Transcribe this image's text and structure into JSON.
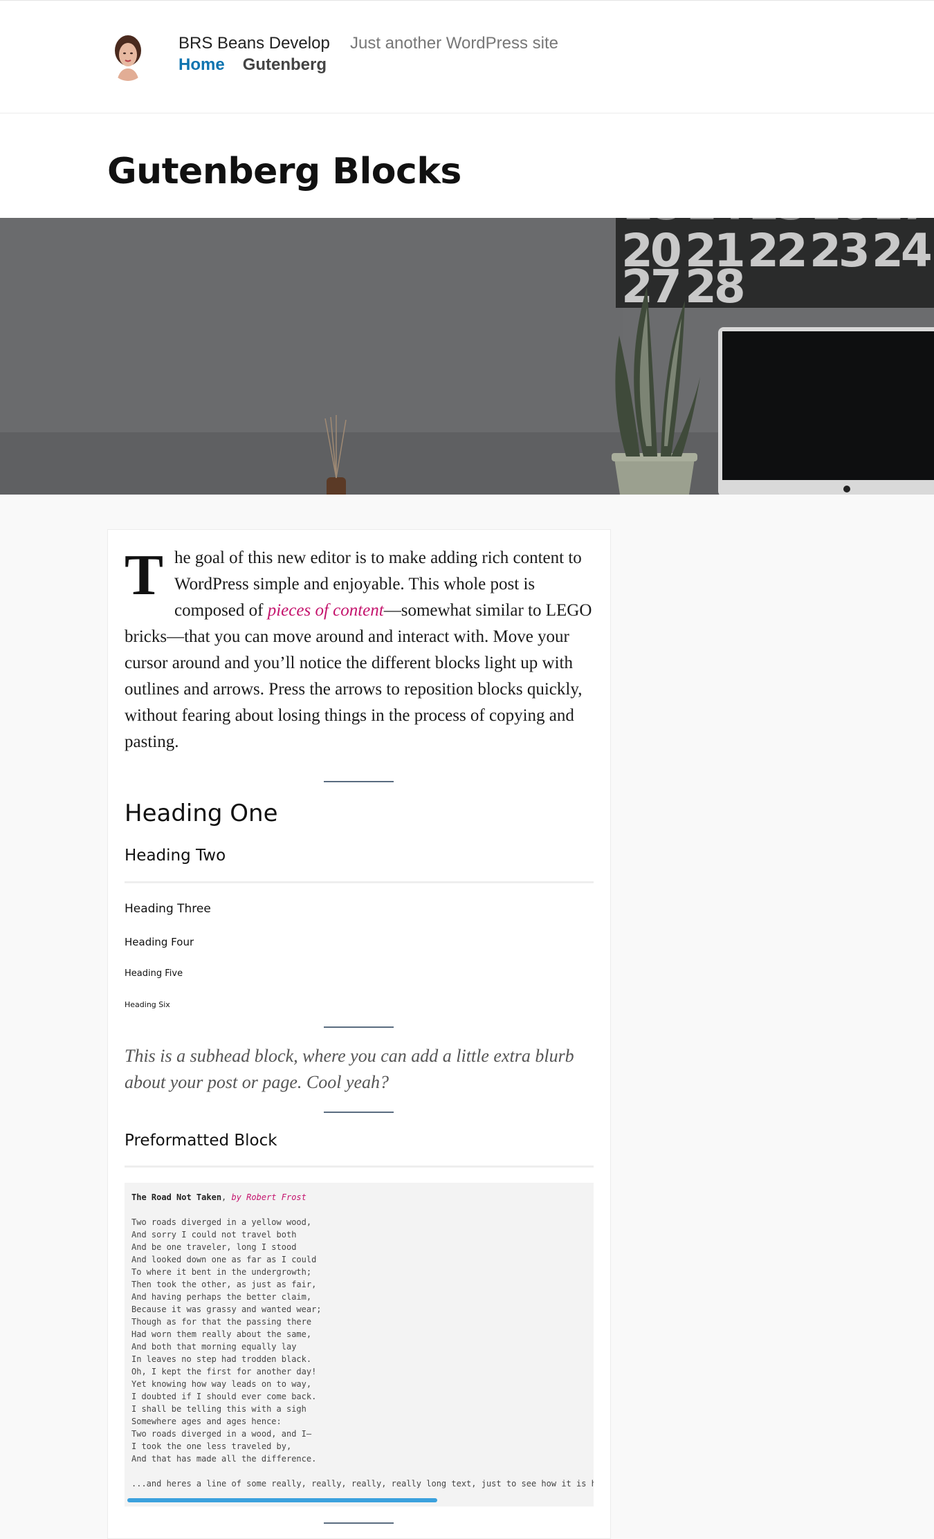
{
  "header": {
    "site_title": "BRS Beans Develop",
    "site_description": "Just another WordPress site",
    "nav": [
      {
        "label": "Home",
        "current": true
      },
      {
        "label": "Gutenberg",
        "current": false
      }
    ],
    "avatar_icon": "avatar"
  },
  "page": {
    "title": "Gutenberg Blocks"
  },
  "hero": {
    "calendar_numbers": [
      "20",
      "21",
      "22",
      "23",
      "24",
      "27",
      "28"
    ]
  },
  "content": {
    "lead_dropcap": "T",
    "lead_before": "he goal of this new editor is to make adding rich content to WordPress simple and enjoyable. This whole post is composed of ",
    "lead_em": "pieces of content",
    "lead_after": "—somewhat similar to LEGO bricks—that you can move around and interact with. Move your cursor around and you’ll notice the different blocks light up with outlines and arrows. Press the arrows to reposition blocks quickly, without fearing about losing things in the process of copying and pasting.",
    "headings": {
      "h1": "Heading One",
      "h2": "Heading Two",
      "h3": "Heading Three",
      "h4": "Heading Four",
      "h5": "Heading Five",
      "h6": "Heading Six"
    },
    "subhead": "This is a subhead block, where you can add a little extra blurb about your post or page. Cool yeah?",
    "preformatted_heading": "Preformatted Block",
    "preformatted": {
      "title": "The Road Not Taken",
      "byline_sep": ", ",
      "byline": "by Robert Frost",
      "body": "Two roads diverged in a yellow wood,\nAnd sorry I could not travel both\nAnd be one traveler, long I stood\nAnd looked down one as far as I could\nTo where it bent in the undergrowth;\nThen took the other, as just as fair,\nAnd having perhaps the better claim,\nBecause it was grassy and wanted wear;\nThough as for that the passing there\nHad worn them really about the same,\nAnd both that morning equally lay\nIn leaves no step had trodden black.\nOh, I kept the first for another day!\nYet knowing how way leads on to way,\nI doubted if I should ever come back.\nI shall be telling this with a sigh\nSomewhere ages and ages hence:\nTwo roads diverged in a wood, and I—\nI took the one less traveled by,\nAnd that has made all the difference.",
      "long_line": "...and heres a line of some really, really, really, really long text, just to see how it is handled and to find out how it overflows;"
    }
  },
  "colors": {
    "link_current": "#0f74b0",
    "em_accent": "#c4146d",
    "scrollbar": "#3ba1dd"
  }
}
